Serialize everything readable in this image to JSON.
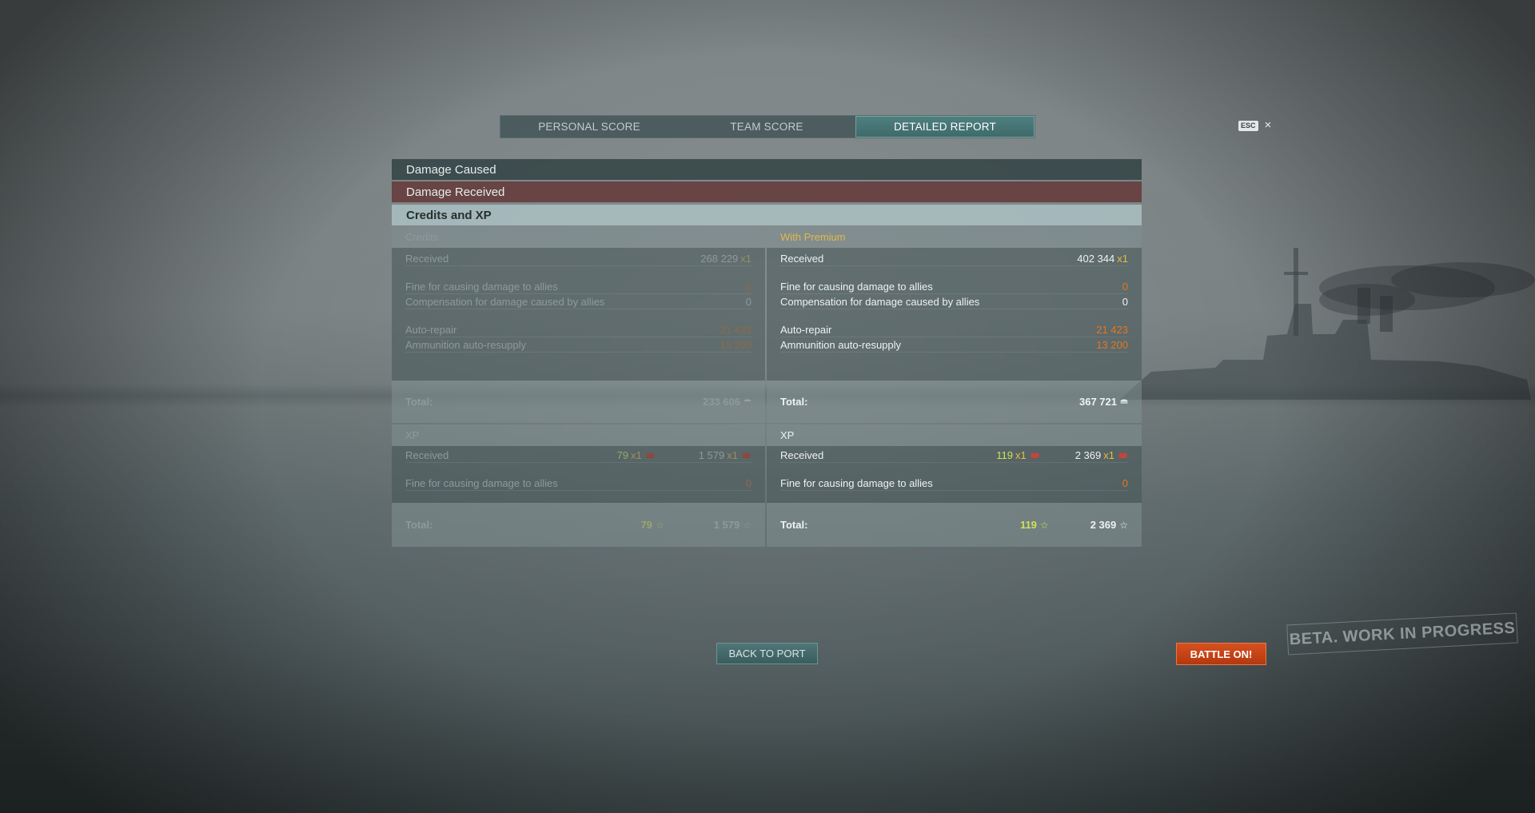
{
  "tabs": [
    {
      "label": "PERSONAL SCORE",
      "active": false
    },
    {
      "label": "TEAM SCORE",
      "active": false
    },
    {
      "label": "DETAILED REPORT",
      "active": true
    }
  ],
  "esc": {
    "key": "ESC",
    "close_glyph": "×"
  },
  "sections": {
    "damage_caused": "Damage Caused",
    "damage_received": "Damage Received",
    "credits_xp": "Credits and XP"
  },
  "credits": {
    "standard": {
      "title": "Credits",
      "received_label": "Received",
      "received_value": "268 229",
      "multiplier": "x1",
      "fine_label": "Fine for causing damage to allies",
      "fine_value": "0",
      "compensation_label": "Compensation for damage caused by allies",
      "compensation_value": "0",
      "autorepair_label": "Auto-repair",
      "autorepair_value": "21 423",
      "resupply_label": "Ammunition auto-resupply",
      "resupply_value": "13 200",
      "total_label": "Total:",
      "total_value": "233 606"
    },
    "premium": {
      "title": "With Premium",
      "received_label": "Received",
      "received_value": "402 344",
      "multiplier": "x1",
      "fine_label": "Fine for causing damage to allies",
      "fine_value": "0",
      "compensation_label": "Compensation for damage caused by allies",
      "compensation_value": "0",
      "autorepair_label": "Auto-repair",
      "autorepair_value": "21 423",
      "resupply_label": "Ammunition auto-resupply",
      "resupply_value": "13 200",
      "total_label": "Total:",
      "total_value": "367 721"
    }
  },
  "xp": {
    "standard": {
      "title": "XP",
      "received_label": "Received",
      "ship_xp": "79",
      "ship_mult": "x1",
      "total_xp": "1 579",
      "total_mult": "x1",
      "fine_label": "Fine for causing damage to allies",
      "fine_value": "0",
      "total_label": "Total:",
      "total_ship_xp": "79",
      "total_total_xp": "1 579"
    },
    "premium": {
      "title": "XP",
      "received_label": "Received",
      "ship_xp": "119",
      "ship_mult": "x1",
      "total_xp": "2 369",
      "total_mult": "x1",
      "fine_label": "Fine for causing damage to allies",
      "fine_value": "0",
      "total_label": "Total:",
      "total_ship_xp": "119",
      "total_total_xp": "2 369"
    }
  },
  "buttons": {
    "back_to_port": "BACK TO PORT",
    "battle_on": "BATTLE ON!"
  },
  "watermark": "BETA. WORK IN PROGRESS",
  "icons": {
    "credits": "coin-icon",
    "xp_flag": "emblem-icon",
    "xp_star": "star-icon",
    "close": "close-icon"
  }
}
